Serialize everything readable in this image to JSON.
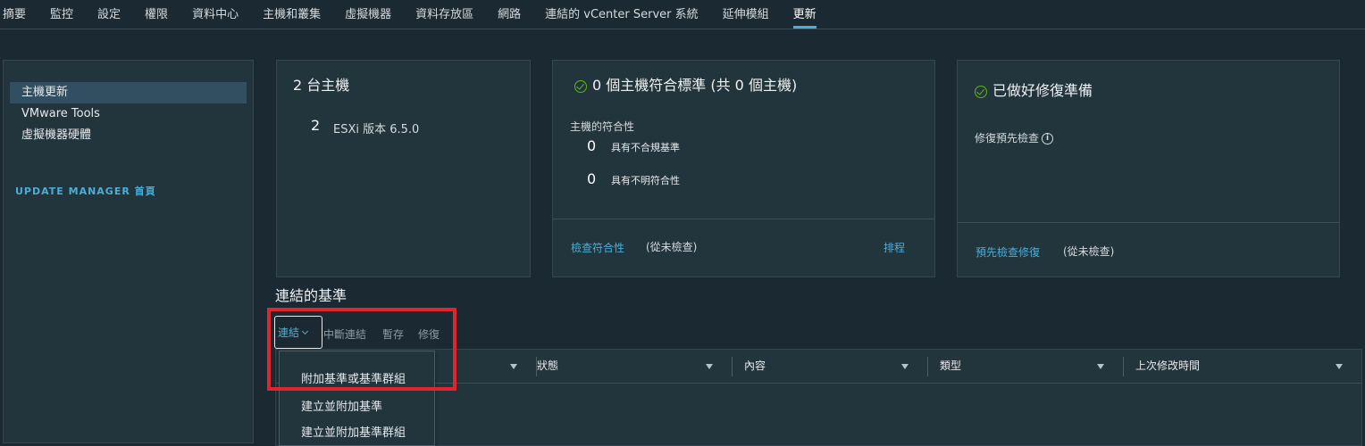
{
  "tabs": [
    "摘要",
    "監控",
    "設定",
    "權限",
    "資料中心",
    "主機和叢集",
    "虛擬機器",
    "資料存放區",
    "網路",
    "連結的 vCenter Server 系統",
    "延伸模組",
    "更新"
  ],
  "active_tab": "更新",
  "sidebar": {
    "items": [
      {
        "label": "主機更新",
        "selected": true
      },
      {
        "label": "VMware Tools",
        "selected": false
      },
      {
        "label": "虛擬機器硬體",
        "selected": false
      }
    ],
    "home_link": "UPDATE MANAGER 首頁"
  },
  "hosts_card": {
    "title": "2 台主機",
    "count": "2",
    "version_label": "ESXi 版本 6.5.0"
  },
  "compliance_card": {
    "title": "0 個主機符合標準 (共 0 個主機)",
    "subtitle": "主機的符合性",
    "noncompliant_count": "0",
    "noncompliant_label": "具有不合規基準",
    "unknown_count": "0",
    "unknown_label": "具有不明符合性",
    "check_link": "檢查符合性",
    "check_status": "(從未檢查)",
    "schedule_link": "排程"
  },
  "remediation_card": {
    "title": "已做好修復準備",
    "precheck_label": "修復預先檢查",
    "precheck_link": "預先檢查修復",
    "precheck_status": "(從未檢查)"
  },
  "baselines": {
    "heading": "連結的基準",
    "actions": {
      "attach": "連結",
      "detach": "中斷連結",
      "stage": "暫存",
      "remediate": "修復"
    },
    "columns": [
      "狀態",
      "內容",
      "類型",
      "上次修改時間"
    ],
    "dropdown": [
      "附加基準或基準群組",
      "建立並附加基準",
      "建立並附加基準群組"
    ]
  },
  "colors": {
    "accent": "#49afd9",
    "ok": "#5eb715",
    "highlight": "#e1252f"
  }
}
